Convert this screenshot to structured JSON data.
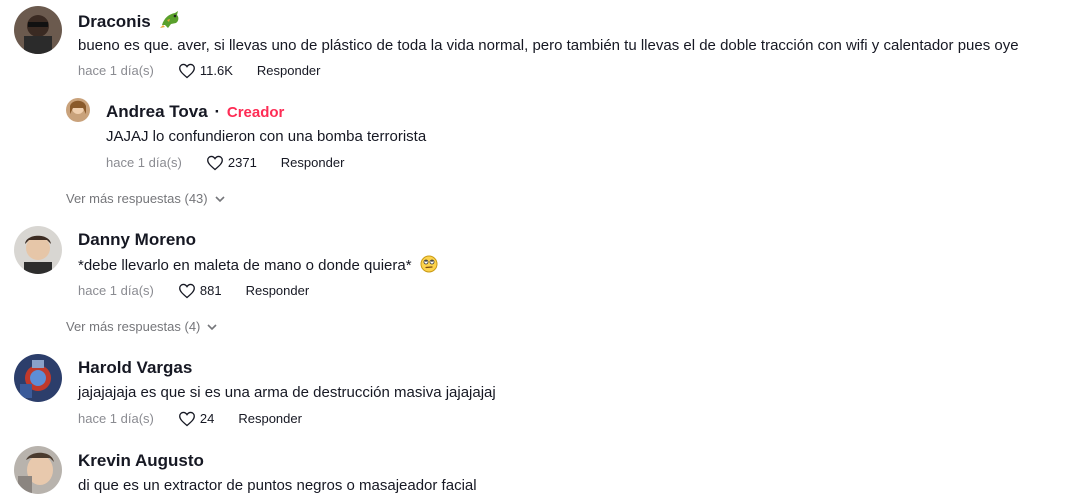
{
  "comments": [
    {
      "author": "Draconis",
      "text": "bueno es que. aver, si llevas uno de plástico de toda la vida normal, pero también tu llevas el de doble tracción con wifi y calentador pues oye",
      "time": "hace 1 día(s)",
      "likes": "11.6K",
      "reply_label": "Responder",
      "author_emoji": "dragon-emoji",
      "replies": [
        {
          "author": "Andrea Tova",
          "separator": "·",
          "badge": "Creador",
          "text": "JAJAJ lo confundieron con una bomba terrorista",
          "time": "hace 1 día(s)",
          "likes": "2371",
          "reply_label": "Responder"
        }
      ],
      "more_replies": "Ver más respuestas (43)"
    },
    {
      "author": "Danny Moreno",
      "text": "*debe llevarlo en maleta de mano o donde quiera*",
      "text_emoji": "eye-roll-emoji",
      "time": "hace 1 día(s)",
      "likes": "881",
      "reply_label": "Responder",
      "more_replies": "Ver más respuestas (4)"
    },
    {
      "author": "Harold Vargas",
      "text": "jajajajaja es que si es una arma de destrucción masiva jajajajaj",
      "time": "hace 1 día(s)",
      "likes": "24",
      "reply_label": "Responder"
    },
    {
      "author": "Krevin Augusto",
      "text": "di que es un extractor de puntos negros o masajeador facial"
    }
  ],
  "colors": {
    "creator_badge": "#fe2c55",
    "muted": "#8a8b91",
    "text": "#161823"
  }
}
